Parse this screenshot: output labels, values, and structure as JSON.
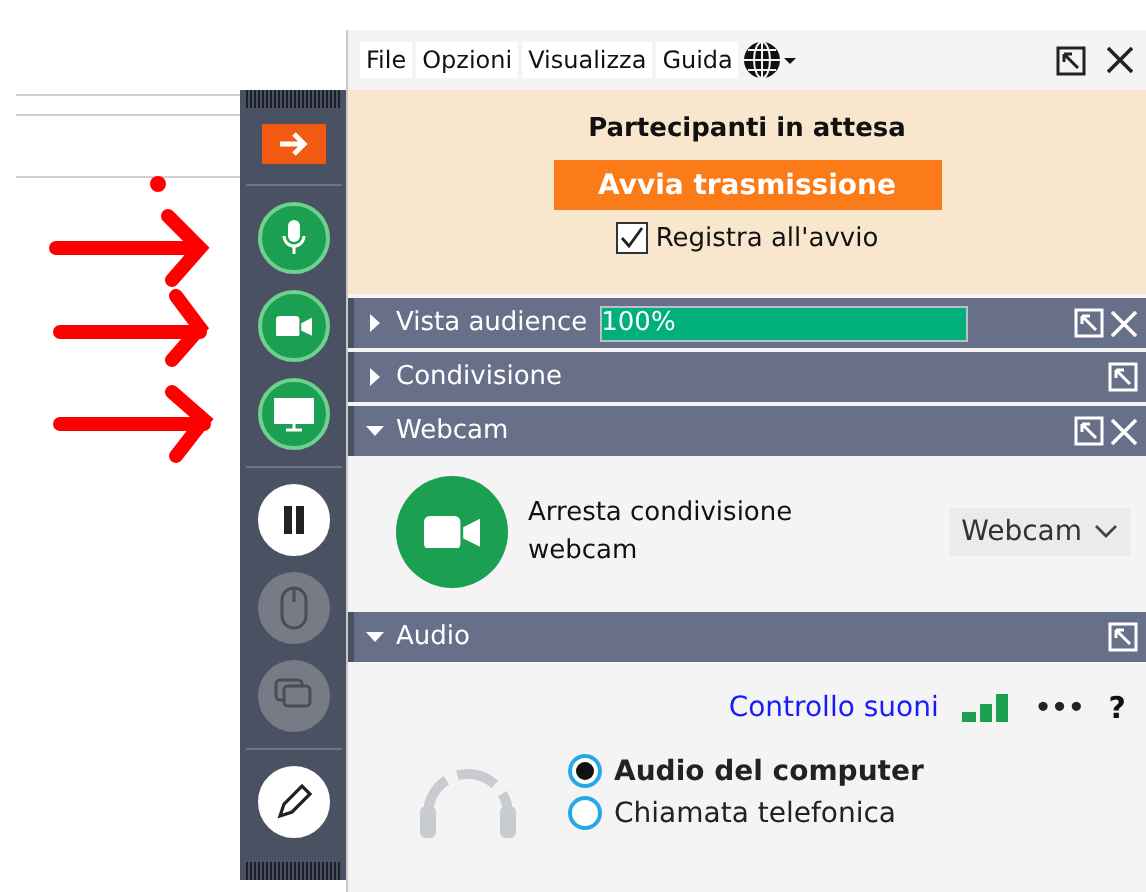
{
  "toolbar": {
    "buttons": [
      {
        "kind": "arrow"
      },
      {
        "kind": "mic"
      },
      {
        "kind": "camera"
      },
      {
        "kind": "screen"
      },
      {
        "kind": "pause"
      },
      {
        "kind": "mouse"
      },
      {
        "kind": "screens"
      },
      {
        "kind": "pen"
      }
    ]
  },
  "menu": [
    "File",
    "Opzioni",
    "Visualizza",
    "Guida"
  ],
  "waiting": {
    "title": "Partecipanti in attesa",
    "start_button": "Avvia trasmissione",
    "record": {
      "label": "Registra all'avvio",
      "checked": true
    }
  },
  "sections": [
    {
      "title": "Vista audience",
      "expanded": false,
      "level": 1,
      "reading": "100%",
      "closable": true
    },
    {
      "title": "Condivisione",
      "expanded": false,
      "closable": false
    },
    {
      "title": "Webcam",
      "expanded": true,
      "closable": true
    },
    {
      "title": "Audio",
      "expanded": true,
      "closable": false
    }
  ],
  "webcam": {
    "action": "Arresta condivisione webcam",
    "device": "Webcam"
  },
  "audio": {
    "link": "Controllo suoni",
    "more": "•••",
    "help": "?",
    "options": [
      {
        "label": "Audio del computer",
        "selected": true
      },
      {
        "label": "Chiamata telefonica",
        "selected": false
      }
    ]
  }
}
